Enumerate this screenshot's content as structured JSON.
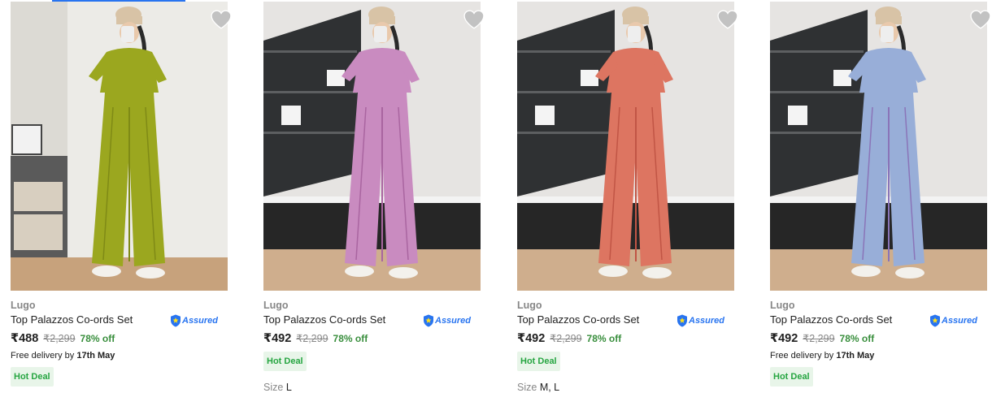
{
  "products": [
    {
      "brand": "Lugo",
      "title": "Top Palazzos Co-ords Set",
      "assured": "Assured",
      "price": "₹488",
      "mrp": "₹2,299",
      "discount": "78% off",
      "delivery_prefix": "Free delivery by",
      "delivery_date": "17th May",
      "deal": "Hot Deal",
      "image": {
        "outfit_color": "#9ba71f",
        "outfit_shade": "#7f8a16",
        "background": "#ecebe7"
      }
    },
    {
      "brand": "Lugo",
      "title": "Top Palazzos Co-ords Set",
      "assured": "Assured",
      "price": "₹492",
      "mrp": "₹2,299",
      "discount": "78% off",
      "deal": "Hot Deal",
      "size_label": "Size",
      "size_value": "L",
      "image": {
        "outfit_color": "#c98bc0",
        "outfit_shade": "#a965a0",
        "background": "#e6e4e2"
      }
    },
    {
      "brand": "Lugo",
      "title": "Top Palazzos Co-ords Set",
      "assured": "Assured",
      "price": "₹492",
      "mrp": "₹2,299",
      "discount": "78% off",
      "deal": "Hot Deal",
      "size_label": "Size",
      "size_value": "M, L",
      "image": {
        "outfit_color": "#dd7561",
        "outfit_shade": "#c15545",
        "background": "#e6e4e2"
      }
    },
    {
      "brand": "Lugo",
      "title": "Top Palazzos Co-ords Set",
      "assured": "Assured",
      "price": "₹492",
      "mrp": "₹2,299",
      "discount": "78% off",
      "delivery_prefix": "Free delivery by",
      "delivery_date": "17th May",
      "deal": "Hot Deal",
      "image": {
        "outfit_color": "#98aed8",
        "outfit_shade": "#8a74b8",
        "background": "#e6e4e2"
      }
    }
  ],
  "icons": {
    "wishlist": "heart-icon",
    "assured_badge": "shield-icon"
  },
  "colors": {
    "brand_blue": "#2874f0",
    "discount_green": "#388e3c",
    "deal_bg": "#e8f5e9",
    "deal_text": "#26a541",
    "wishlist_gray": "#c2c2c2"
  }
}
